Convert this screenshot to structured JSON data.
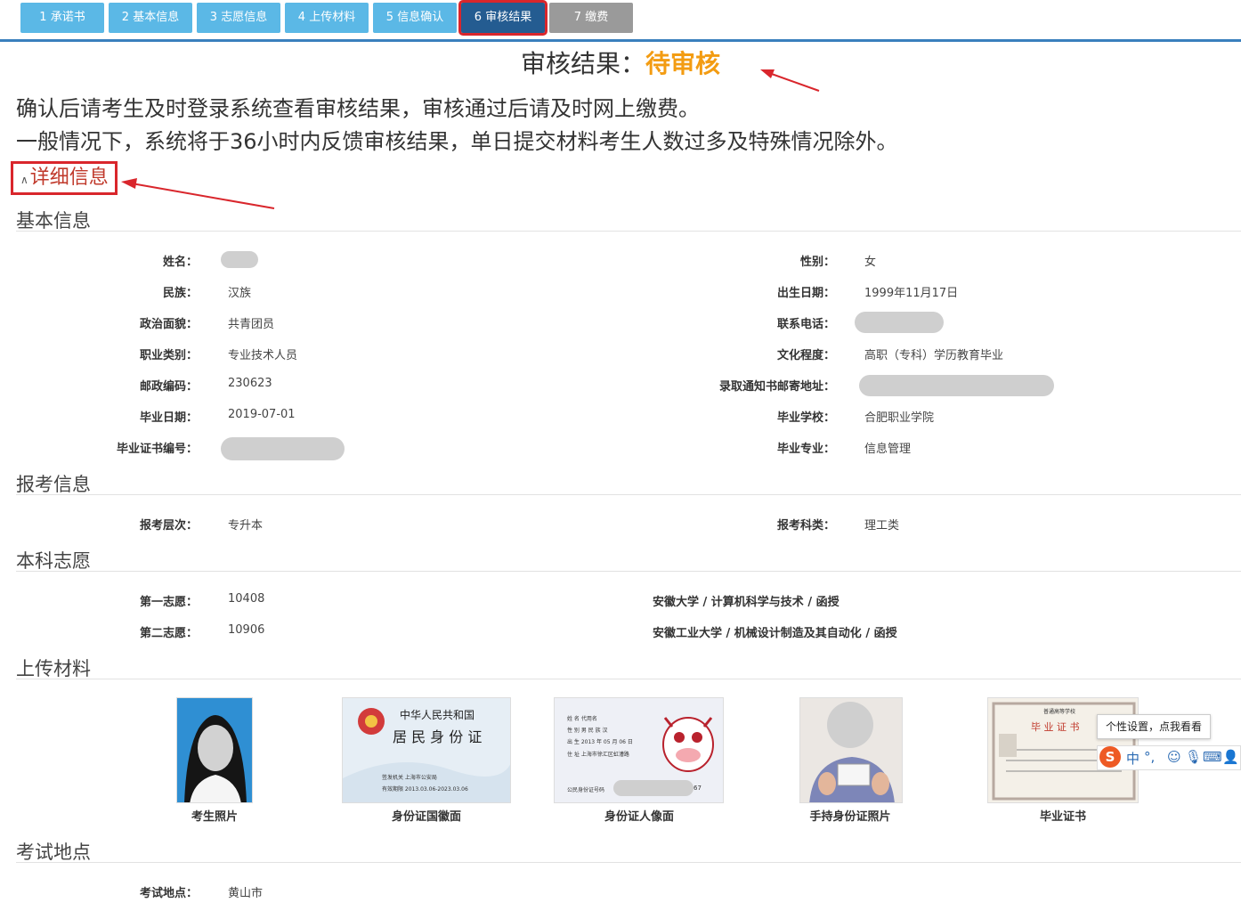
{
  "steps": [
    {
      "label": "1 承诺书"
    },
    {
      "label": "2 基本信息"
    },
    {
      "label": "3 志愿信息"
    },
    {
      "label": "4 上传材料"
    },
    {
      "label": "5 信息确认"
    },
    {
      "label": "6 审核结果"
    },
    {
      "label": "7 缴费"
    }
  ],
  "result": {
    "label": "审核结果：",
    "status": "待审核"
  },
  "notice": {
    "line1": "确认后请考生及时登录系统查看审核结果，审核通过后请及时网上缴费。",
    "line2": "一般情况下，系统将于36小时内反馈审核结果，单日提交材料考生人数过多及特殊情况除外。"
  },
  "detail_toggle": {
    "caret": "∧",
    "label": "详细信息"
  },
  "basic": {
    "title": "基本信息",
    "name_label": "姓名：",
    "gender_label": "性别：",
    "gender": "女",
    "ethnic_label": "民族：",
    "ethnic": "汉族",
    "birth_label": "出生日期：",
    "birth": "1999年11月17日",
    "political_label": "政治面貌：",
    "political": "共青团员",
    "phone_label": "联系电话：",
    "job_label": "职业类别：",
    "job": "专业技术人员",
    "edu_label": "文化程度：",
    "edu": "高职（专科）学历教育毕业",
    "zip_label": "邮政编码：",
    "zip": "230623",
    "address_label": "录取通知书邮寄地址：",
    "grad_date_label": "毕业日期：",
    "grad_date": "2019-07-01",
    "school_label": "毕业学校：",
    "school": "合肥职业学院",
    "cert_no_label": "毕业证书编号：",
    "major_label": "毕业专业：",
    "major": "信息管理"
  },
  "exam": {
    "title": "报考信息",
    "level_label": "报考层次：",
    "level": "专升本",
    "category_label": "报考科类：",
    "category": "理工类"
  },
  "wishes": {
    "title": "本科志愿",
    "first_label": "第一志愿：",
    "first_code": "10408",
    "first_detail": "安徽大学 / 计算机科学与技术 / 函授",
    "second_label": "第二志愿：",
    "second_code": "10906",
    "second_detail": "安徽工业大学 / 机械设计制造及其自动化 / 函授"
  },
  "uploads": {
    "title": "上传材料",
    "items": [
      "考生照片",
      "身份证国徽面",
      "身份证人像面",
      "手持身份证照片",
      "毕业证书"
    ],
    "idcard_back_line1": "中华人民共和国",
    "idcard_back_line2": "居 民 身 份 证",
    "idcard_back_authority": "签发机关   上海市公安局",
    "idcard_back_validity": "有效期限   2013.03.06-2023.03.06",
    "idcard_front_name": "姓 名  代用名",
    "idcard_front_gender": "性 别  男     民 族  汉",
    "idcard_front_birth": "出 生  2013  年  05  月  06  日",
    "idcard_front_address": "住 址  上海市徐汇区虹漕路",
    "idcard_front_id_label": "公民身份证号码",
    "idcard_front_id_tail": "67",
    "diploma_school": "普通高等学校",
    "diploma_title": "毕 业 证 书"
  },
  "location": {
    "title": "考试地点",
    "label": "考试地点：",
    "value": "黄山市"
  },
  "ime": {
    "tooltip": "个性设置，点我看看",
    "logo": "S",
    "mode": "中",
    "punct": "°,"
  },
  "colors": {
    "accent": "#5bb8e6",
    "active": "#245c91",
    "status": "#f39c12",
    "highlight": "#d9262c"
  }
}
